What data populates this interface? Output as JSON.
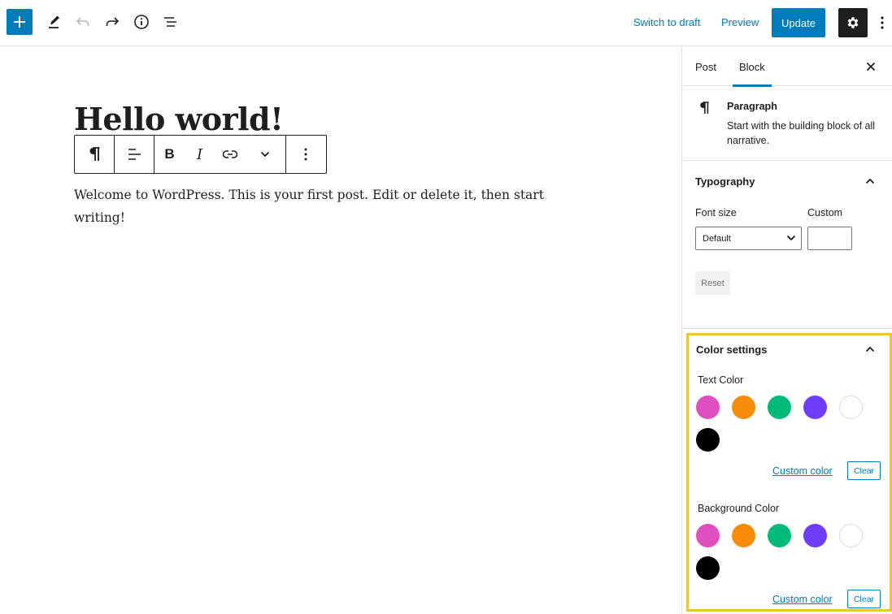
{
  "toolbar": {
    "switch_to_draft": "Switch to draft",
    "preview": "Preview",
    "update": "Update",
    "icons": [
      "plus-icon",
      "pencil-icon",
      "undo-icon",
      "redo-icon",
      "info-icon",
      "list-view-icon",
      "gear-icon",
      "more-vertical-icon"
    ]
  },
  "editor": {
    "title": "Hello world!",
    "body": "Welcome to WordPress. This is your first post. Edit or delete it, then start writing!",
    "block_toolbar": {
      "bold": "B",
      "italic": "I"
    }
  },
  "sidebar": {
    "tabs": [
      {
        "label": "Post",
        "active": false
      },
      {
        "label": "Block",
        "active": true
      }
    ],
    "block": {
      "name": "Paragraph",
      "description": "Start with the building block of all narrative."
    },
    "typography": {
      "title": "Typography",
      "font_size_label": "Font size",
      "font_size_value": "Default",
      "custom_label": "Custom",
      "reset": "Reset"
    },
    "color_settings": {
      "title": "Color settings",
      "text_color_label": "Text Color",
      "background_color_label": "Background Color",
      "custom_color": "Custom color",
      "clear": "Clear",
      "palette": [
        "#e04fbf",
        "#f78b0a",
        "#00ba78",
        "#6f3df9",
        "#ffffff",
        "#000000"
      ]
    }
  },
  "colors": {
    "accent": "#007cba",
    "dark": "#1e1e1e",
    "highlight": "#f0c33c"
  }
}
